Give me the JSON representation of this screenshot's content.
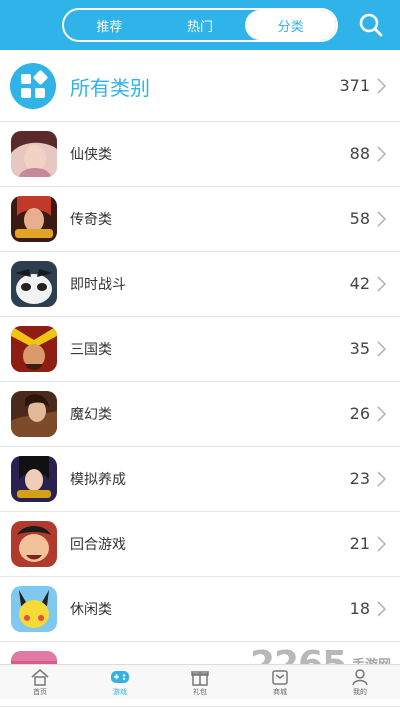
{
  "header": {
    "tabs": [
      {
        "label": "推荐",
        "active": false
      },
      {
        "label": "热门",
        "active": false
      },
      {
        "label": "分类",
        "active": true
      }
    ],
    "search_icon": "search-icon",
    "color": "#2fb3e8"
  },
  "all_categories": {
    "label": "所有类别",
    "count": "371",
    "icon": "category-grid-icon"
  },
  "categories": [
    {
      "name": "仙侠类",
      "count": "88"
    },
    {
      "name": "传奇类",
      "count": "58"
    },
    {
      "name": "即时战斗",
      "count": "42"
    },
    {
      "name": "三国类",
      "count": "35"
    },
    {
      "name": "魔幻类",
      "count": "26"
    },
    {
      "name": "模拟养成",
      "count": "23"
    },
    {
      "name": "回合游戏",
      "count": "21"
    },
    {
      "name": "休闲类",
      "count": "18"
    },
    {
      "name": "",
      "count": ""
    }
  ],
  "bottom_nav": [
    {
      "label": "首页",
      "icon": "home-icon",
      "active": false
    },
    {
      "label": "游戏",
      "icon": "gamepad-icon",
      "active": true
    },
    {
      "label": "礼包",
      "icon": "gift-icon",
      "active": false
    },
    {
      "label": "商城",
      "icon": "shop-icon",
      "active": false
    },
    {
      "label": "我的",
      "icon": "user-icon",
      "active": false
    }
  ],
  "watermark": {
    "main": "2265",
    "sub": "手游网"
  }
}
